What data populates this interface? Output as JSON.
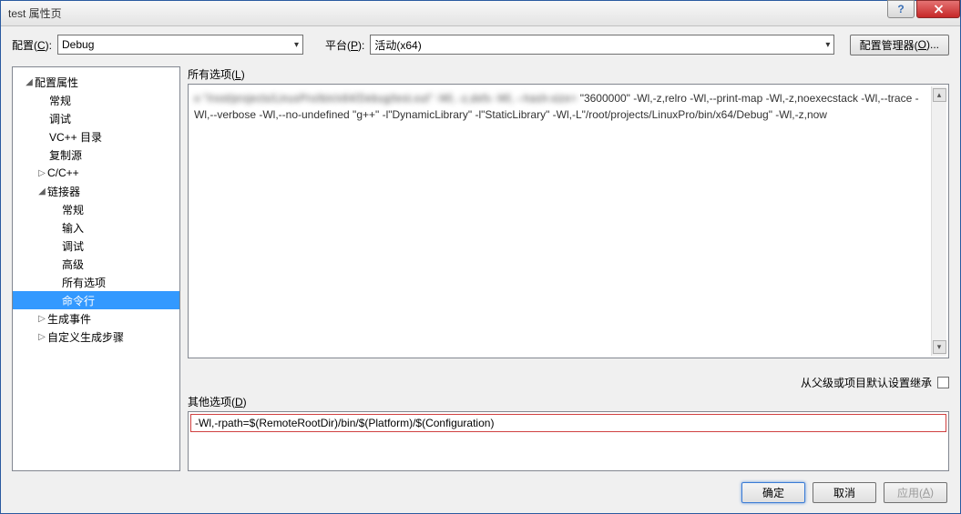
{
  "window": {
    "title": "test 属性页"
  },
  "toolbar": {
    "config_label_pre": "配置(",
    "config_label_key": "C",
    "config_label_post": "):",
    "config_value": "Debug",
    "platform_label_pre": "平台(",
    "platform_label_key": "P",
    "platform_label_post": "):",
    "platform_value": "活动(x64)",
    "manager_pre": "配置管理器(",
    "manager_key": "O",
    "manager_post": ")..."
  },
  "tree": {
    "root": "配置属性",
    "items_level1": [
      "常规",
      "调试",
      "VC++ 目录",
      "复制源"
    ],
    "cpp": "C/C++",
    "linker": "链接器",
    "linker_children": [
      "常规",
      "输入",
      "调试",
      "高级",
      "所有选项",
      "命令行"
    ],
    "build_events": "生成事件",
    "custom_build": "自定义生成步骤"
  },
  "right": {
    "all_options_label_pre": "所有选项(",
    "all_options_label_key": "L",
    "all_options_label_post": ")",
    "all_options_text_prefix_blur": "o \"/root/projects/LinuxPro/bin/x64/Debug/test.out\" -Wl, -z,defs -Wl, --hash-size=",
    "all_options_text_tail": " \"3600000\" -Wl,-z,relro -Wl,--print-map -Wl,-z,noexecstack -Wl,--trace -Wl,--verbose -Wl,--no-undefined \"g++\" -l\"DynamicLibrary\" -l\"StaticLibrary\" -Wl,-L\"/root/projects/LinuxPro/bin/x64/Debug\" -Wl,-z,now",
    "inherit_label": "从父级或项目默认设置继承",
    "other_options_label_pre": "其他选项(",
    "other_options_label_key": "D",
    "other_options_label_post": ")",
    "other_options_value": "-Wl,-rpath=$(RemoteRootDir)/bin/$(Platform)/$(Configuration)"
  },
  "footer": {
    "ok": "确定",
    "cancel": "取消",
    "apply_pre": "应用(",
    "apply_key": "A",
    "apply_post": ")"
  }
}
